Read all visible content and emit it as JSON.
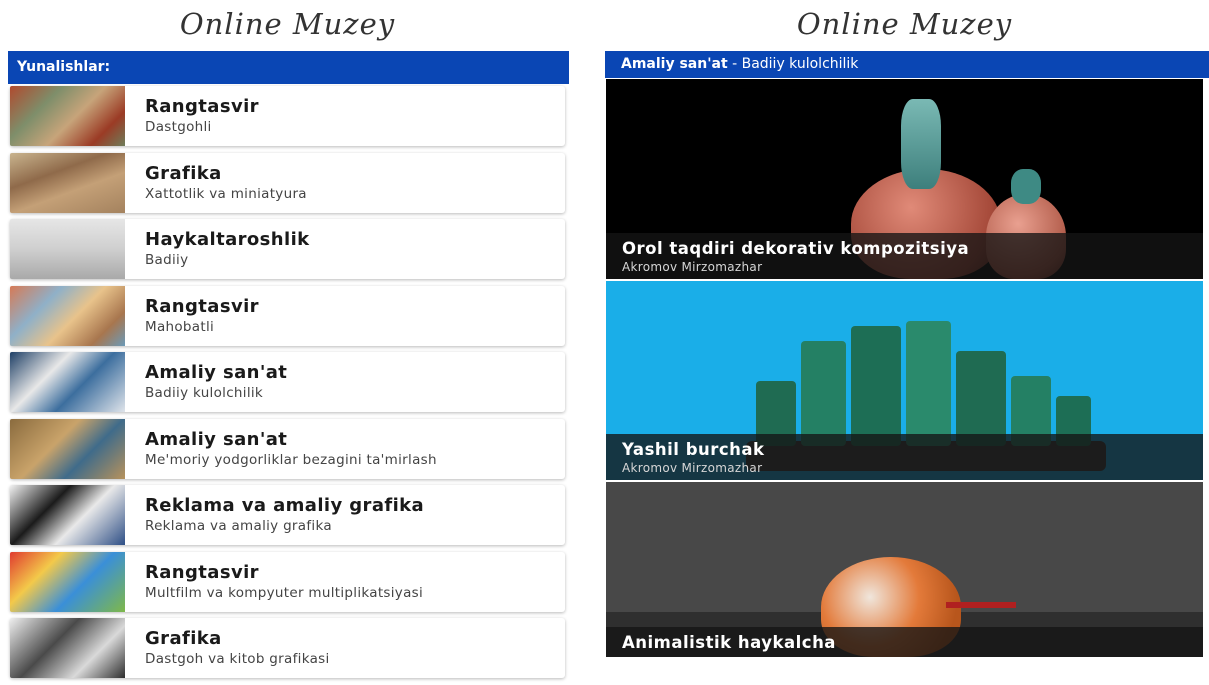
{
  "left": {
    "logo": "Online Muzey",
    "header_label": "Yunalishlar:",
    "items": [
      {
        "title": "Rangtasvir",
        "subtitle": "Dastgohli"
      },
      {
        "title": "Grafika",
        "subtitle": "Xattotlik va miniatyura"
      },
      {
        "title": "Haykaltaroshlik",
        "subtitle": "Badiiy"
      },
      {
        "title": "Rangtasvir",
        "subtitle": "Mahobatli"
      },
      {
        "title": "Amaliy san'at",
        "subtitle": "Badiiy kulolchilik"
      },
      {
        "title": "Amaliy san'at",
        "subtitle": "Me'moriy yodgorliklar bezagini ta'mirlash"
      },
      {
        "title": "Reklama va amaliy grafika",
        "subtitle": "Reklama va amaliy grafika"
      },
      {
        "title": "Rangtasvir",
        "subtitle": "Multfilm va kompyuter multiplikatsiyasi"
      },
      {
        "title": "Grafika",
        "subtitle": "Dastgoh va kitob grafikasi"
      }
    ]
  },
  "right": {
    "logo": "Online Muzey",
    "header_category": "Amaliy san'at",
    "header_subcategory": " - Badiiy kulolchilik",
    "cards": [
      {
        "title": "Orol taqdiri dekorativ kompozitsiya",
        "author": "Akromov Mirzomazhar"
      },
      {
        "title": "Yashil burchak",
        "author": "Akromov Mirzomazhar"
      },
      {
        "title": "Animalistik haykalcha",
        "author": ""
      }
    ]
  },
  "colors": {
    "header_bar": "#0a46b4",
    "card_caption_bg": "#141414"
  }
}
